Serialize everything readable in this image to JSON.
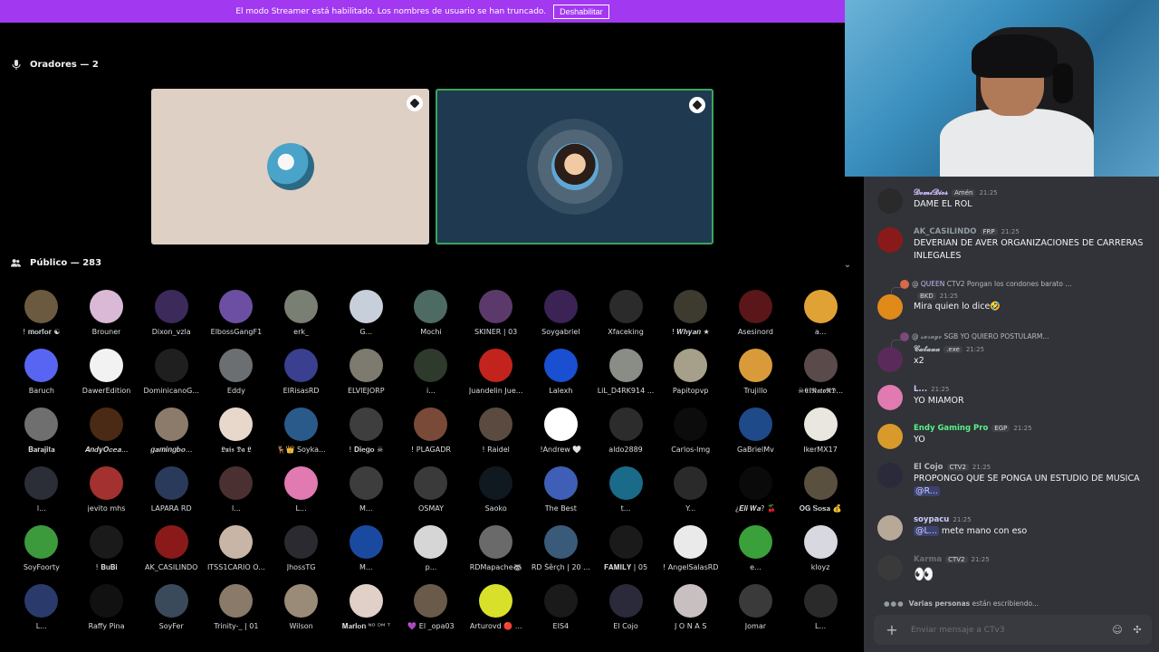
{
  "banner": {
    "text": "El modo Streamer está habilitado. Los nombres de usuario se han truncado.",
    "button": "Deshabilitar"
  },
  "speakers": {
    "label": "Oradores — 2"
  },
  "audience": {
    "label": "Público — 283",
    "members": [
      {
        "name": "! 𝐦𝐨𝐫𝐟𝐨𝐫 ☯",
        "color": "#6b5a3f"
      },
      {
        "name": "Brouner",
        "color": "#d9b9d6"
      },
      {
        "name": "Dixon_vzla",
        "color": "#3b2a5a"
      },
      {
        "name": "ElbossGangF1",
        "color": "#6c4fa3"
      },
      {
        "name": "erk_",
        "color": "#7a7f73"
      },
      {
        "name": "G...",
        "color": "#c7d0da"
      },
      {
        "name": "Mochi",
        "color": "#4d6b63"
      },
      {
        "name": "SKINER | 03",
        "color": "#5b3a6b"
      },
      {
        "name": "Soygabriel",
        "color": "#3c2355"
      },
      {
        "name": "Xfaceking",
        "color": "#2b2b2b"
      },
      {
        "name": "! 𝑾𝒉𝒚𝒂𝒏 ★",
        "color": "#3d3b2f"
      },
      {
        "name": "Asesinord",
        "color": "#5a1618"
      },
      {
        "name": "a...",
        "color": "#e0a235"
      },
      {
        "name": "Baruch",
        "color": "#5865f2"
      },
      {
        "name": "DawerEdition",
        "color": "#f2f2f2"
      },
      {
        "name": "DominicanoG...",
        "color": "#1f1f1f"
      },
      {
        "name": "Eddy",
        "color": "#6b6f72"
      },
      {
        "name": "ElRisasRD",
        "color": "#3a3f8f"
      },
      {
        "name": "ELVIEJORP",
        "color": "#7d7a70"
      },
      {
        "name": "i...",
        "color": "#2d3a2c"
      },
      {
        "name": "Juandelin Jue...",
        "color": "#c2241d"
      },
      {
        "name": "Lalexh",
        "color": "#1b4fd1"
      },
      {
        "name": "LiL_D4RK914 ...",
        "color": "#8a8c86"
      },
      {
        "name": "Papitopvp",
        "color": "#a6a08a"
      },
      {
        "name": "Trujillo",
        "color": "#d99b3a"
      },
      {
        "name": "☠𝕰𝖑𝕹𝖆𝖙𝖔𝕽𝕯...",
        "color": "#5a4a4a"
      },
      {
        "name": "𝐁𝐚𝐫𝐚𝐣𝐢𝐭𝐚",
        "color": "#6f6f6f"
      },
      {
        "name": "𝑨𝒏𝒅𝒚𝑶𝒄𝒆𝒂...",
        "color": "#4a2a14"
      },
      {
        "name": "𝒈𝒂𝒎𝒊𝒏𝒈𝒃𝒐...",
        "color": "#8c7a6a"
      },
      {
        "name": "𝕷𝖚𝖎𝖘 𝕯𝖆 𝕷",
        "color": "#e8d8cc"
      },
      {
        "name": "🦌👑 Soyka...",
        "color": "#2a5a8a"
      },
      {
        "name": "! 𝐃𝐢𝐞𝐠𝐨 ☠",
        "color": "#3e3e3e"
      },
      {
        "name": "! PLAGADR",
        "color": "#7a4a38"
      },
      {
        "name": "! Raidel",
        "color": "#5a4a40"
      },
      {
        "name": "!Andrew 🤍",
        "color": "#ffffff"
      },
      {
        "name": "aldo2889",
        "color": "#2c2c2c"
      },
      {
        "name": "Carlos-lmg",
        "color": "#0c0c0c"
      },
      {
        "name": "GaBrielMv",
        "color": "#1e4a8a"
      },
      {
        "name": "IkerMX17",
        "color": "#eae6e0"
      },
      {
        "name": "l...",
        "color": "#2b2e36"
      },
      {
        "name": "jevito mhs",
        "color": "#a2312f"
      },
      {
        "name": "LAPARA RD",
        "color": "#2a3a5a"
      },
      {
        "name": "l...",
        "color": "#4a3030"
      },
      {
        "name": "L...",
        "color": "#e07ab0"
      },
      {
        "name": "M...",
        "color": "#3d3d3d"
      },
      {
        "name": "OSMAY",
        "color": "#3a3a3a"
      },
      {
        "name": "Saoko",
        "color": "#101820"
      },
      {
        "name": "The Best",
        "color": "#3e5fb5"
      },
      {
        "name": "t...",
        "color": "#1a6a8a"
      },
      {
        "name": "Y...",
        "color": "#2a2a2a"
      },
      {
        "name": "¿𝑬𝒍𝒊 𝑾𝒂? 🍒",
        "color": "#0a0a0a"
      },
      {
        "name": "𝐎𝐆 𝐒𝐨𝐬𝐚 💰",
        "color": "#5a5040"
      },
      {
        "name": "SoyFoorty",
        "color": "#3c9a3c"
      },
      {
        "name": "! 𝐁𝐮𝐁𝐢",
        "color": "#1a1a1a"
      },
      {
        "name": "AK_CASILINDO",
        "color": "#8a1a1a"
      },
      {
        "name": "ITSS1CARIO O...",
        "color": "#c8b5a5"
      },
      {
        "name": "JhossTG",
        "color": "#2a2a30"
      },
      {
        "name": "M...",
        "color": "#1a4aa0"
      },
      {
        "name": "p...",
        "color": "#d6d6d6"
      },
      {
        "name": "RDMapache🦝",
        "color": "#6a6a6a"
      },
      {
        "name": "RD Šêrçh | 20 ...",
        "color": "#3a5a7a"
      },
      {
        "name": "𝐅𝐀𝐌𝐈𝐋𝐘 | 05",
        "color": "#1a1a1a"
      },
      {
        "name": "! AngelSalasRD",
        "color": "#eaeaea"
      },
      {
        "name": "e...",
        "color": "#3aa03a"
      },
      {
        "name": "kloyz",
        "color": "#d8d8e0"
      },
      {
        "name": "L...",
        "color": "#2a3a6a"
      },
      {
        "name": "Raffy Pina",
        "color": "#111111"
      },
      {
        "name": "SoyFer",
        "color": "#3a4a5a"
      },
      {
        "name": "Trinity-_ | 01",
        "color": "#8a7a6a"
      },
      {
        "name": "Wilson",
        "color": "#9a8a78"
      },
      {
        "name": "𝐌𝐚𝐫𝐥𝐨𝐧 ᴺᴼ ᴰᴹ ᵀ",
        "color": "#e0d0c8"
      },
      {
        "name": "💜 El _opa03",
        "color": "#6a5a4a"
      },
      {
        "name": "Arturovd 🔴 ...",
        "color": "#d8e02a"
      },
      {
        "name": "EIS4",
        "color": "#1a1a1a"
      },
      {
        "name": "El Cojo",
        "color": "#2a2a3a"
      },
      {
        "name": "J O N A S",
        "color": "#c8c0c0"
      },
      {
        "name": "Jomar",
        "color": "#3a3a3a"
      },
      {
        "name": "L...",
        "color": "#2a2a2a"
      }
    ]
  },
  "chat": {
    "messages": [
      {
        "author": "𝓓𝓸𝓶𝓲𝓓𝓲𝓸𝓼",
        "author_color": "#c9b8f2",
        "tag": "Amén",
        "time": "21:25",
        "text": "DAME EL ROL",
        "avatar_color": "#2a2a2a"
      },
      {
        "author": "AK_CASILINDO",
        "author_color": "#949ba4",
        "tag": "FRP",
        "time": "21:25",
        "text": "DEVERIAN DE AVER  ORGANIZACIONES  DE CARRERAS INLEGALES",
        "avatar_color": "#8a1a1a"
      },
      {
        "author": "",
        "author_color": "#b5bac1",
        "tag": "BKD",
        "time": "21:25",
        "text": "Mira quien lo dice🤣",
        "avatar_color": "#e08a1a"
      },
      {
        "author": "𝓒𝓪𝓽𝓪𝓪𝓪",
        "author_color": "#b5bac1",
        "tag": ".exe",
        "time": "21:25",
        "text": "x2",
        "avatar_color": "#5a2a5a"
      },
      {
        "author": "L...",
        "author_color": "#c9cdfb",
        "tag": "",
        "time": "21:25",
        "text": "YO MIAMOR",
        "avatar_color": "#e07ab0"
      },
      {
        "author": "Endy Gaming Pro",
        "author_color": "#57f287",
        "tag": "EGP",
        "time": "21:25",
        "text": "YO",
        "avatar_color": "#d89a2a"
      },
      {
        "author": "El Cojo",
        "author_color": "#b5bac1",
        "tag": "CTV2",
        "time": "21:25",
        "text": "PROPONGO QUE SE PONGA UN ESTUDIO  DE MUSICA",
        "mention": "@R...",
        "avatar_color": "#2a2a3a"
      },
      {
        "author": "soypacu",
        "author_color": "#c9cdfb",
        "tag": "",
        "time": "21:25",
        "text": "mete mano con eso",
        "mention": "@L...",
        "avatar_color": "#b8a898"
      },
      {
        "author": "Karma",
        "author_color": "#6d6f78",
        "tag": "CTV2",
        "time": "21:25",
        "text": "👀",
        "avatar_color": "#3a3a3a"
      }
    ],
    "replies": [
      {
        "author": "QUEEN",
        "tag": "CTV2",
        "text": "Pongan los condones barato ..."
      },
      {
        "author": "𝓼𝓪𝓻𝓪𝓰𝓸",
        "tag": "SGB",
        "text": "YO QUIERO POSTULARM..."
      }
    ],
    "typing_who": "Varias personas",
    "typing_suffix": "están escribiendo...",
    "composer_placeholder": "Enviar mensaje a CTv3"
  },
  "colors": {
    "banner": "#a238f0",
    "speaking_ring": "#3ba55c",
    "chat_bg": "#313338",
    "blurple": "#5865f2"
  }
}
